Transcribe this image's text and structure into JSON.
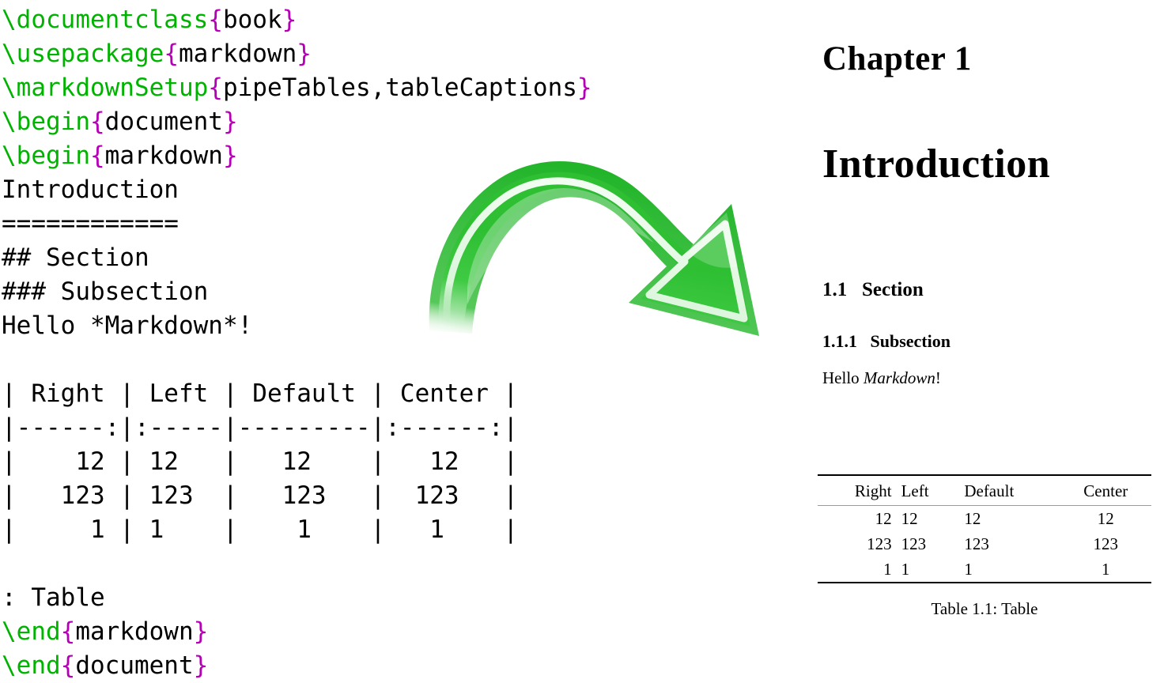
{
  "source": {
    "language": "latex",
    "colors": {
      "control_sequence": "#00b300",
      "brace": "#b500b5",
      "plain": "#000000",
      "background": "#ffffff"
    },
    "lines": [
      {
        "cs": "\\documentclass",
        "open": "{",
        "arg": "book",
        "close": "}"
      },
      {
        "cs": "\\usepackage",
        "open": "{",
        "arg": "markdown",
        "close": "}"
      },
      {
        "cs": "\\markdownSetup",
        "open": "{",
        "arg": "pipeTables,tableCaptions",
        "close": "}"
      },
      {
        "cs": "\\begin",
        "open": "{",
        "arg": "document",
        "close": "}"
      },
      {
        "cs": "\\begin",
        "open": "{",
        "arg": "markdown",
        "close": "}"
      },
      {
        "plain": "Introduction"
      },
      {
        "plain": "============"
      },
      {
        "plain": "## Section"
      },
      {
        "plain": "### Subsection"
      },
      {
        "plain": "Hello *Markdown*!"
      },
      {
        "plain": ""
      },
      {
        "plain": "| Right | Left | Default | Center |"
      },
      {
        "plain": "|------:|:-----|---------|:------:|"
      },
      {
        "plain": "|    12 | 12   |   12    |   12   |"
      },
      {
        "plain": "|   123 | 123  |   123   |  123   |"
      },
      {
        "plain": "|     1 | 1    |    1    |   1    |"
      },
      {
        "plain": ""
      },
      {
        "plain": ": Table"
      },
      {
        "cs": "\\end",
        "open": "{",
        "arg": "markdown",
        "close": "}"
      },
      {
        "cs": "\\end",
        "open": "{",
        "arg": "document",
        "close": "}"
      }
    ]
  },
  "arrow": {
    "icon": "curved-arrow-right-down-icon",
    "color_body": "#2ecc32",
    "color_outline": "#22b52a",
    "color_highlight": "#d6f5d6",
    "direction": "source-to-output"
  },
  "output": {
    "chapter_number": "Chapter 1",
    "chapter_title": "Introduction",
    "section_heading": "1.1   Section",
    "subsection_heading": "1.1.1   Subsection",
    "paragraph_prefix": "Hello ",
    "paragraph_emphasis": "Markdown",
    "paragraph_suffix": "!",
    "table": {
      "headers": [
        "Right",
        "Left",
        "Default",
        "Center"
      ],
      "alignments": [
        "right",
        "left",
        "default",
        "center"
      ],
      "rows": [
        [
          "12",
          "12",
          "12",
          "12"
        ],
        [
          "123",
          "123",
          "123",
          "123"
        ],
        [
          "1",
          "1",
          "1",
          "1"
        ]
      ],
      "caption": "Table 1.1: Table"
    }
  }
}
